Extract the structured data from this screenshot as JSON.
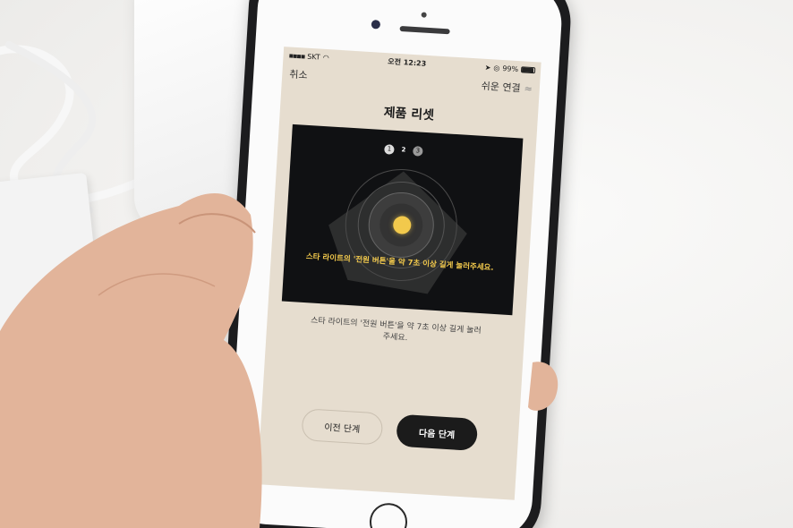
{
  "status": {
    "carrier": "SKT",
    "time": "오전 12:23",
    "battery": "99%"
  },
  "nav": {
    "cancel": "취소",
    "easy_connect": "쉬운 연결"
  },
  "page": {
    "title": "제품 리셋"
  },
  "illustration": {
    "steps": [
      "1",
      "2",
      "3"
    ],
    "caption": "스타 라이트의 '전원 버튼'을 약 7초 이상 길게 눌러주세요."
  },
  "description": "스타 라이트의 '전원 버튼'을 약 7초 이상 길게 눌러 주세요.",
  "buttons": {
    "prev": "이전 단계",
    "next": "다음 단계"
  },
  "colors": {
    "accent": "#f2c94c",
    "screen_bg": "#e6ddcf",
    "button_dark": "#1b1b1b"
  }
}
